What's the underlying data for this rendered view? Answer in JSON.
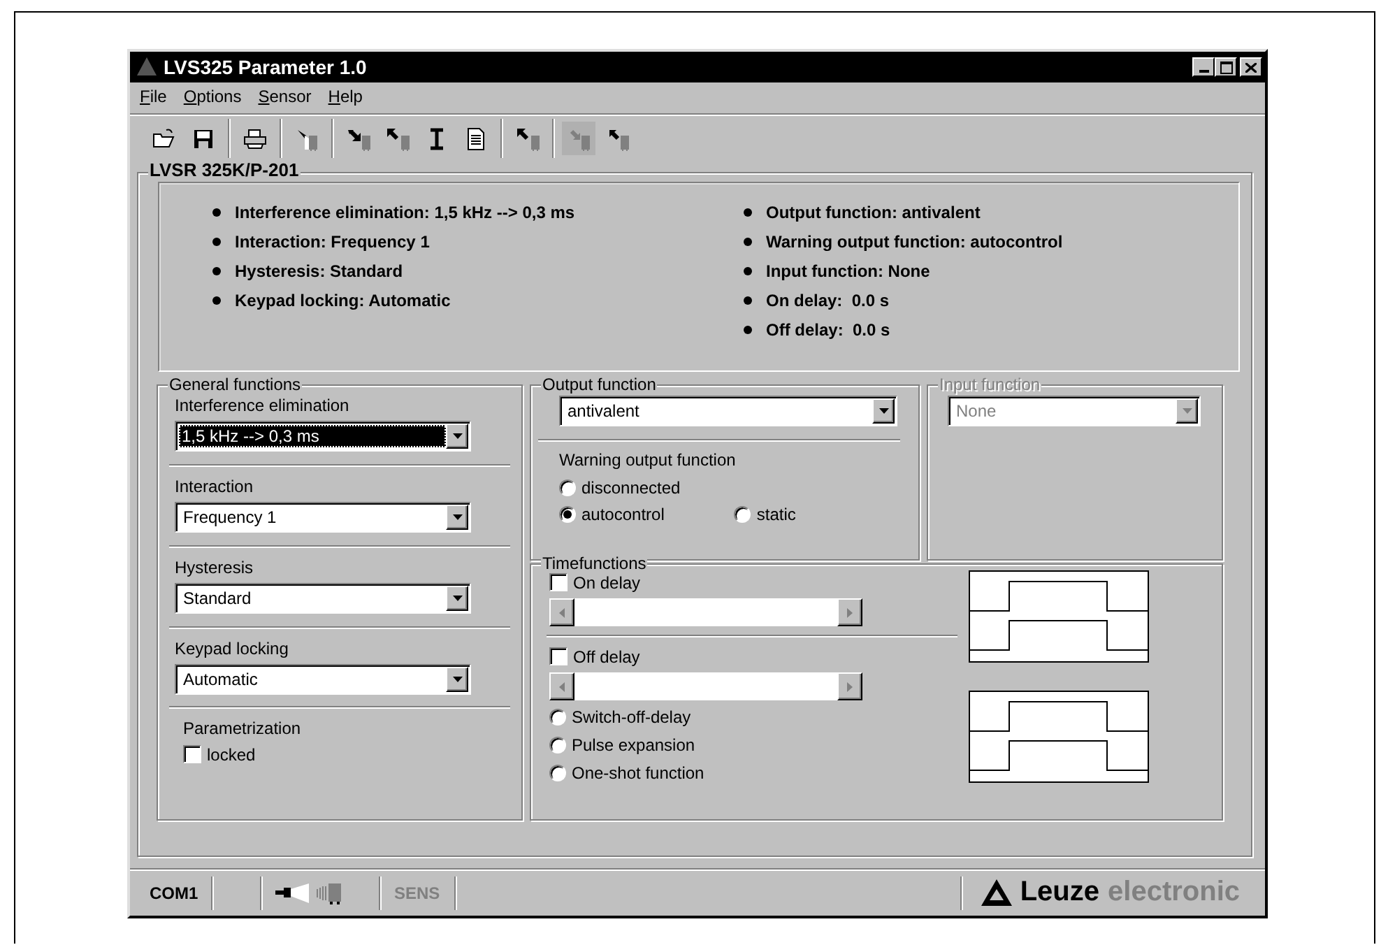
{
  "window": {
    "title": "LVS325 Parameter 1.0"
  },
  "menu": [
    {
      "label": "File",
      "underline_first": true
    },
    {
      "label": "Options",
      "underline_first": true
    },
    {
      "label": "Sensor",
      "underline_first": true
    },
    {
      "label": "Help",
      "underline_first": true
    }
  ],
  "toolbar": [
    [
      {
        "kind": "open",
        "disabled": false
      },
      {
        "kind": "save",
        "disabled": false
      }
    ],
    [
      {
        "kind": "print",
        "disabled": false
      }
    ],
    [
      {
        "kind": "torch",
        "disabled": false
      }
    ],
    [
      {
        "kind": "download",
        "disabled": false
      },
      {
        "kind": "upload",
        "disabled": false
      },
      {
        "kind": "text",
        "disabled": false
      },
      {
        "kind": "document",
        "disabled": false
      }
    ],
    [
      {
        "kind": "upload",
        "disabled": false
      }
    ],
    [
      {
        "kind": "send",
        "disabled": true
      },
      {
        "kind": "receive",
        "disabled": false
      }
    ]
  ],
  "device": {
    "title": "LVSR 325K/P-201"
  },
  "summary": {
    "left": [
      "Interference elimination: 1,5 kHz --> 0,3 ms",
      "Interaction: Frequency 1",
      "Hysteresis: Standard",
      "Keypad locking: Automatic"
    ],
    "right": [
      "Output function: antivalent",
      "Warning output function: autocontrol",
      "Input function: None",
      "On delay:  0.0 s",
      "Off delay:  0.0 s"
    ]
  },
  "general": {
    "title": "General functions",
    "combos": [
      {
        "label": "Interference elimination",
        "value": "1,5 kHz --> 0,3 ms",
        "focused": true
      },
      {
        "label": "Interaction",
        "value": "Frequency 1",
        "focused": false
      },
      {
        "label": "Hysteresis",
        "value": "Standard",
        "focused": false
      },
      {
        "label": "Keypad locking",
        "value": "Automatic",
        "focused": false
      }
    ],
    "lock": {
      "title": "Parametrization",
      "label": "locked",
      "checked": false
    }
  },
  "output": {
    "title": "Output function",
    "value": "antivalent",
    "warning_title": "Warning output function",
    "warning_options": [
      {
        "label": "disconnected",
        "selected": false
      },
      {
        "label": "autocontrol",
        "selected": true
      },
      {
        "label": "static",
        "selected": false
      }
    ]
  },
  "input": {
    "title": "Input function",
    "value": "None",
    "disabled": true
  },
  "time": {
    "title": "Timefunctions",
    "delays": [
      {
        "label": "On delay",
        "checked": false
      },
      {
        "label": "Off delay",
        "checked": false
      }
    ],
    "modes": [
      {
        "label": "Switch-off-delay",
        "selected": false
      },
      {
        "label": "Pulse expansion",
        "selected": false
      },
      {
        "label": "One-shot function",
        "selected": false
      }
    ]
  },
  "status_bar": {
    "port": "COM1",
    "sensor": "SENS",
    "sensor_disabled": true,
    "brand": "Leuze",
    "brand_suffix": "electronic"
  }
}
